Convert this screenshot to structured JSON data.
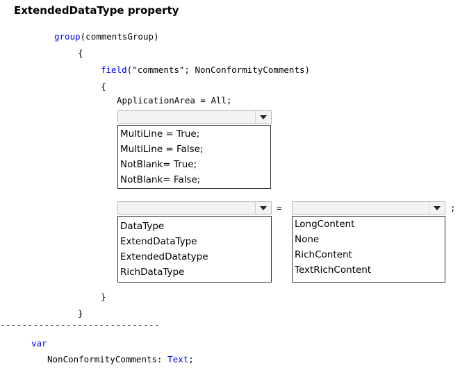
{
  "title": "ExtendedDataType property",
  "code": {
    "group_kw": "group",
    "group_arg": "(commentsGroup)",
    "open_brace_1": "{",
    "field_kw": "field",
    "field_args": "(\"comments\"; NonConformityComments)",
    "open_brace_2": "{",
    "application_area": "ApplicationArea = All;",
    "close_brace_2": "}",
    "close_brace_1": "}",
    "separator": "-----------------------------",
    "var_kw": "var",
    "var_decl": "NonConformityComments: ",
    "var_type": "Text",
    "var_end": ";"
  },
  "dropdown1": {
    "selected": "",
    "options": [
      "MultiLine = True;",
      "MultiLine = False;",
      "NotBlank= True;",
      "NotBlank= False;"
    ]
  },
  "dropdown2": {
    "selected": "",
    "options": [
      "DataType",
      "ExtendDataType",
      "ExtendedDatatype",
      "RichDataType"
    ]
  },
  "equals": "=",
  "dropdown3": {
    "selected": "",
    "options": [
      "LongContent",
      "None",
      "RichContent",
      "TextRichContent"
    ]
  },
  "semicolon": ";",
  "icons": {
    "dropdown_arrow": "chevron-down-icon"
  }
}
